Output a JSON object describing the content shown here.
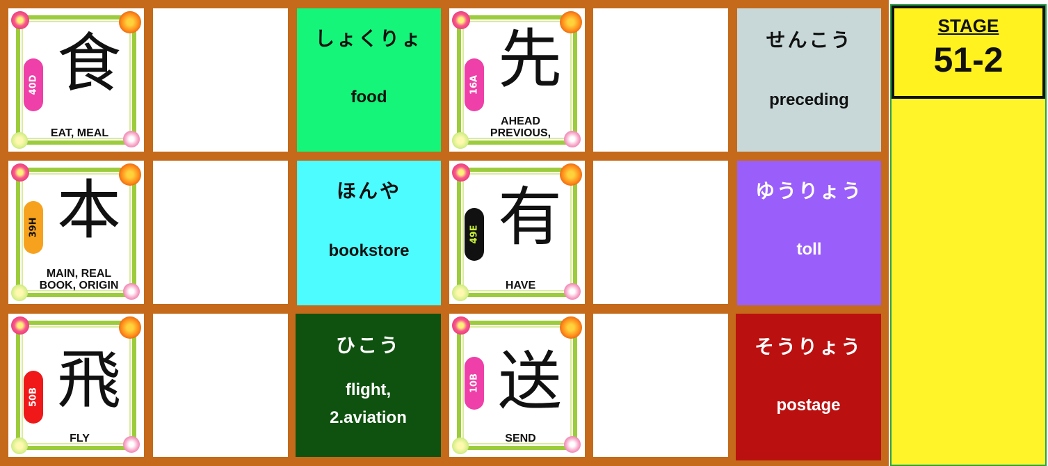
{
  "stage": {
    "label": "STAGE",
    "number": "51-2"
  },
  "rows": [
    {
      "left_card": {
        "kanji": "食",
        "code": "40D",
        "badge_color": "#ef3fa8",
        "code_color": "#ffffff",
        "meaning": "EAT, MEAL"
      },
      "left_word": {
        "reading": "しょくりょ",
        "translation": "food",
        "bg": "#14f57a",
        "fg": "#111111"
      },
      "right_card": {
        "kanji": "先",
        "code": "16A",
        "badge_color": "#ef3fa8",
        "code_color": "#ffffff",
        "meaning": "AHEAD\nPREVIOUS,"
      },
      "right_word": {
        "reading": "せんこう",
        "translation": "preceding",
        "bg": "#c8d8d8",
        "fg": "#111111"
      }
    },
    {
      "left_card": {
        "kanji": "本",
        "code": "39H",
        "badge_color": "#f7a21e",
        "code_color": "#111111",
        "meaning": "MAIN, REAL\nBOOK, ORIGIN"
      },
      "left_word": {
        "reading": "ほんや",
        "translation": "bookstore",
        "bg": "#4dfcff",
        "fg": "#111111"
      },
      "right_card": {
        "kanji": "有",
        "code": "49E",
        "badge_color": "#111111",
        "code_color": "#c7f03a",
        "meaning": "HAVE"
      },
      "right_word": {
        "reading": "ゆうりょう",
        "translation": "toll",
        "bg": "#9a5ffa",
        "fg": "#ffffff"
      }
    },
    {
      "left_card": {
        "kanji": "飛",
        "code": "50B",
        "badge_color": "#f01818",
        "code_color": "#ffffff",
        "meaning": "FLY"
      },
      "left_word": {
        "reading": "ひこう",
        "translation": "flight,\n2.aviation",
        "bg": "#0f520f",
        "fg": "#ffffff"
      },
      "right_card": {
        "kanji": "送",
        "code": "10B",
        "badge_color": "#ef3fa8",
        "code_color": "#ffffff",
        "meaning": "SEND"
      },
      "right_word": {
        "reading": "そうりょう",
        "translation": "postage",
        "bg": "#bb1010",
        "fg": "#ffffff"
      }
    }
  ]
}
